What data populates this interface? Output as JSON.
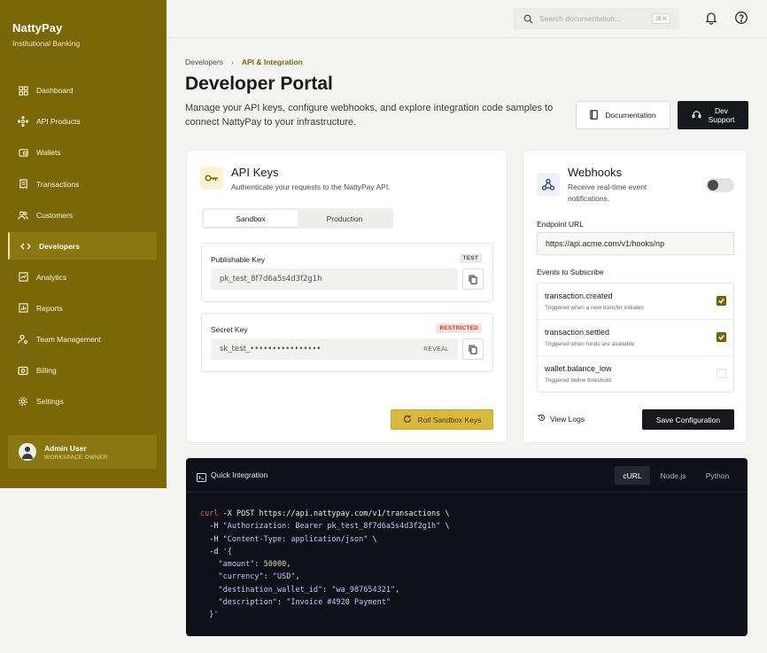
{
  "brand": {
    "name": "NattyPay",
    "subtitle": "Institutional Banking"
  },
  "sidebar": {
    "items": [
      {
        "label": "Dashboard",
        "icon": "grid-icon"
      },
      {
        "label": "API Products",
        "icon": "hub-icon"
      },
      {
        "label": "Wallets",
        "icon": "wallet-icon"
      },
      {
        "label": "Transactions",
        "icon": "receipt-icon"
      },
      {
        "label": "Customers",
        "icon": "users-icon"
      },
      {
        "label": "Developers",
        "icon": "code-icon",
        "active": true
      },
      {
        "label": "Analytics",
        "icon": "chart-icon"
      },
      {
        "label": "Reports",
        "icon": "report-icon"
      },
      {
        "label": "Team Management",
        "icon": "team-icon"
      },
      {
        "label": "Billing",
        "icon": "billing-icon"
      },
      {
        "label": "Settings",
        "icon": "gear-icon"
      }
    ],
    "user": {
      "name": "Admin User",
      "role": "WORKSPACE OWNER"
    }
  },
  "topbar": {
    "search_placeholder": "Search documentation...",
    "shortcut": "⌘ K"
  },
  "breadcrumb": {
    "parent": "Developers",
    "current": "API & Integration"
  },
  "header": {
    "title": "Developer Portal",
    "description": "Manage your API keys, configure webhooks, and explore integration code samples to connect NattyPay to your infrastructure.",
    "doc_button": "Documentation",
    "support_button_line1": "Dev",
    "support_button_line2": "Support"
  },
  "api_keys": {
    "title": "API Keys",
    "subtitle": "Authenticate your requests to the NattyPay API.",
    "tabs": [
      "Sandbox",
      "Production"
    ],
    "publishable": {
      "label": "Publishable Key",
      "badge": "TEST",
      "value": "pk_test_8f7d6a5s4d3f2g1h"
    },
    "secret": {
      "label": "Secret Key",
      "badge": "RESTRICTED",
      "value": "sk_test_••••••••••••••••",
      "reveal": "REVEAL"
    },
    "roll_button": "Roll Sandbox Keys"
  },
  "webhooks": {
    "title": "Webhooks",
    "subtitle": "Receive real-time event notifications.",
    "enabled": false,
    "endpoint_label": "Endpoint URL",
    "endpoint_value": "https://api.acme.com/v1/hooks/np",
    "events_label": "Events to Subscribe",
    "events": [
      {
        "name": "transaction.created",
        "desc": "Triggered when a new transfer initiates",
        "checked": true
      },
      {
        "name": "transaction.settled",
        "desc": "Triggered when funds are available",
        "checked": true
      },
      {
        "name": "wallet.balance_low",
        "desc": "Triggered below threshold",
        "checked": false
      }
    ],
    "view_logs": "View Logs",
    "save_button": "Save Configuration"
  },
  "code": {
    "title": "Quick Integration",
    "tabs": [
      "cURL",
      "Node.js",
      "Python"
    ],
    "active_tab": "cURL",
    "lines": {
      "l1_cmd": "curl",
      "l1_rest": " -X POST https://api.nattypay.com/v1/transactions \\",
      "l2_flag": "  -H ",
      "l2_str": "\"Authorization: Bearer pk_test_8f7d6a5s4d3f2g1h\"",
      "l2_tail": " \\",
      "l3_flag": "  -H ",
      "l3_str": "\"Content-Type: application/json\"",
      "l3_tail": " \\",
      "l4_flag": "  -d ",
      "l4_str": "'{",
      "l5_key": "    \"amount\"",
      "l5_val": "50000",
      "l6_key": "    \"currency\"",
      "l6_val": "\"USD\"",
      "l7_key": "    \"destination_wallet_id\"",
      "l7_val": "\"wa_987654321\"",
      "l8_key": "    \"description\"",
      "l8_val": "\"Invoice #4920 Payment\"",
      "l9": "  }'"
    }
  },
  "colors": {
    "sidebar": "#7a6808",
    "accent": "#d9b840",
    "dark": "#15181d"
  }
}
